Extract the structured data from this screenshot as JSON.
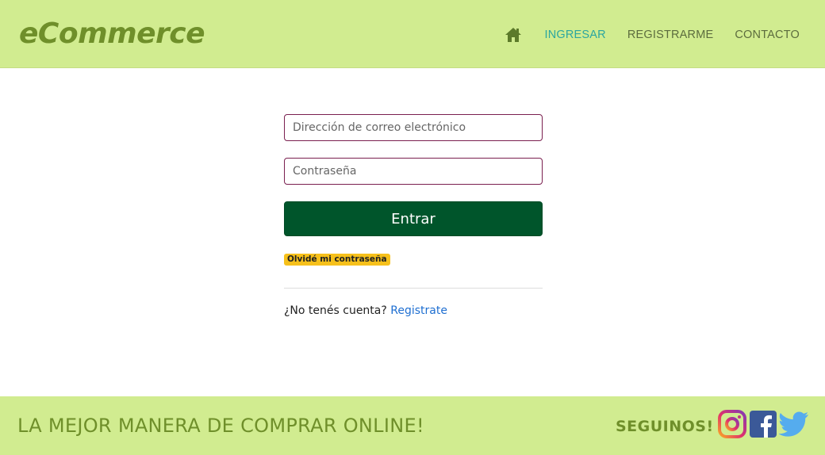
{
  "header": {
    "brand": "eCommerce",
    "nav": {
      "home_icon": "home-icon",
      "login": "INGRESAR",
      "register": "REGISTRARME",
      "contact": "CONTACTO"
    }
  },
  "login_form": {
    "email_placeholder": "Dirección de correo electrónico",
    "password_placeholder": "Contraseña",
    "submit_label": "Entrar",
    "forgot_label": "Olvidé mi contraseña",
    "no_account_text": "¿No tenés cuenta?",
    "register_link": "Registrate"
  },
  "footer": {
    "tagline": "LA MEJOR MANERA DE COMPRAR ONLINE!",
    "follow_label": "SEGUINOS!",
    "social": [
      "instagram-icon",
      "facebook-icon",
      "twitter-icon"
    ]
  },
  "colors": {
    "header_bg": "#d1ec90",
    "brand": "#6f8f2a",
    "active_nav": "#2ba6a0",
    "primary_button": "#00552b",
    "input_border": "#7a1f4f",
    "badge": "#f6c01b",
    "link": "#1f6fd1"
  }
}
